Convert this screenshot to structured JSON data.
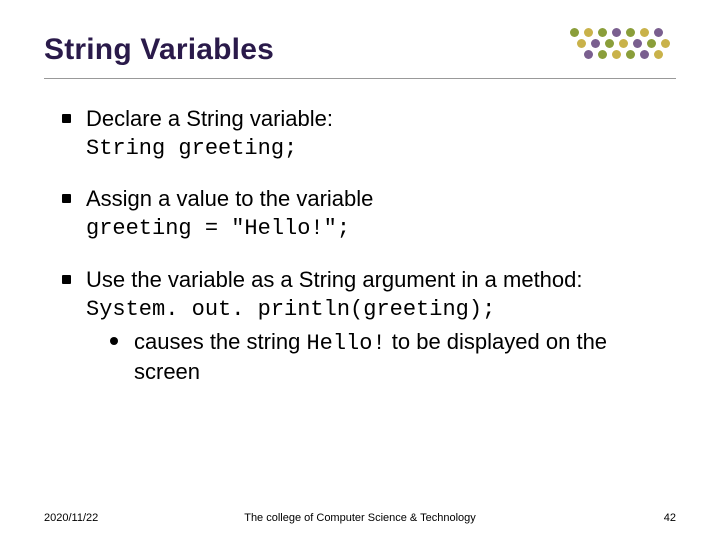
{
  "title": "String Variables",
  "bullets": {
    "b0": {
      "text": "Declare a String variable:",
      "code": "String greeting;"
    },
    "b1": {
      "text": "Assign a value to the variable",
      "code": "greeting = \"Hello!\";"
    },
    "b2": {
      "text": "Use the variable as a String argument in a method:",
      "code": "System. out. println(greeting);",
      "sub_pre": "causes the string ",
      "sub_code": "Hello!",
      "sub_post": " to be displayed on the screen"
    }
  },
  "footer": {
    "date": "2020/11/22",
    "org": "The college of Computer Science & Technology",
    "page": "42"
  },
  "deco": {
    "colors": {
      "g": "#8a9e3a",
      "y": "#c9b24a",
      "p": "#7a5f8f"
    }
  }
}
